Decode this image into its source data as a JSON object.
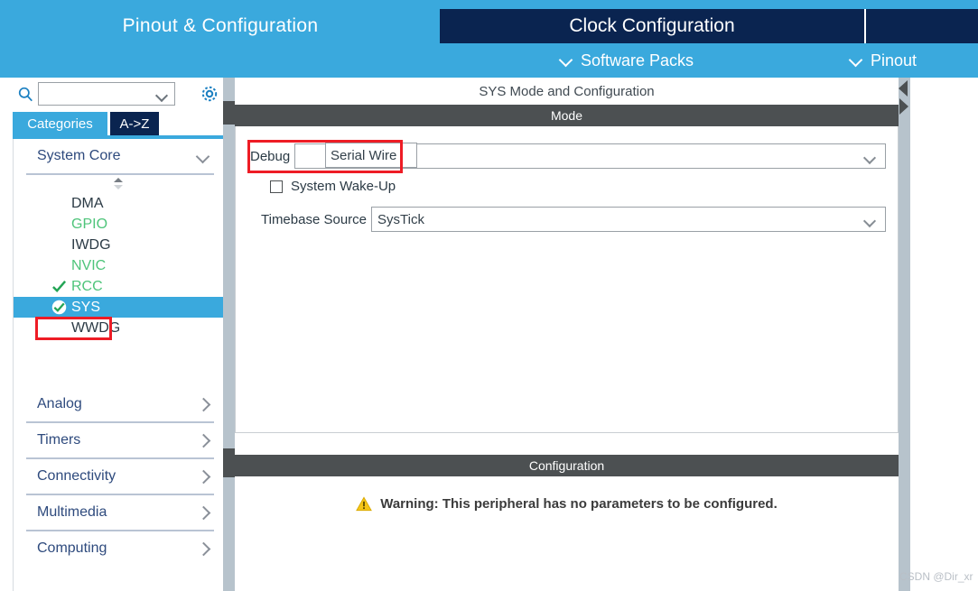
{
  "topbar": {
    "tab_pinout_config": "Pinout & Configuration",
    "tab_clock_config": "Clock Configuration",
    "menu_software_packs": "Software Packs",
    "menu_pinout": "Pinout"
  },
  "sidebar": {
    "search_value": "",
    "search_placeholder": "",
    "tab_categories": "Categories",
    "tab_az": "A->Z",
    "categories": [
      {
        "label": "System Core",
        "expanded": true
      },
      {
        "label": "Analog",
        "expanded": false
      },
      {
        "label": "Timers",
        "expanded": false
      },
      {
        "label": "Connectivity",
        "expanded": false
      },
      {
        "label": "Multimedia",
        "expanded": false
      },
      {
        "label": "Computing",
        "expanded": false
      }
    ],
    "peripherals": [
      {
        "label": "DMA",
        "state": "default",
        "check": false
      },
      {
        "label": "GPIO",
        "state": "green",
        "check": false
      },
      {
        "label": "IWDG",
        "state": "default",
        "check": false
      },
      {
        "label": "NVIC",
        "state": "green",
        "check": false
      },
      {
        "label": "RCC",
        "state": "green",
        "check": true
      },
      {
        "label": "SYS",
        "state": "selected",
        "check": true
      },
      {
        "label": "WWDG",
        "state": "default",
        "check": false
      }
    ]
  },
  "main": {
    "panel_title": "SYS Mode and Configuration",
    "mode_band": "Mode",
    "config_band": "Configuration",
    "debug_label": "Debug",
    "debug_value": "Serial Wire",
    "system_wakeup_label": "System Wake-Up",
    "system_wakeup_checked": false,
    "timebase_label": "Timebase Source",
    "timebase_value": "SysTick",
    "warning_text": "Warning: This peripheral has no parameters to be configured."
  },
  "watermark": "CSDN @Dir_xr",
  "colors": {
    "accent_blue": "#3aa9dd",
    "dark_navy": "#0a2450",
    "band_gray": "#4c5052",
    "green": "#4ec47a",
    "annotation_red": "#ee1c25",
    "warning_yellow": "#f5c518"
  }
}
